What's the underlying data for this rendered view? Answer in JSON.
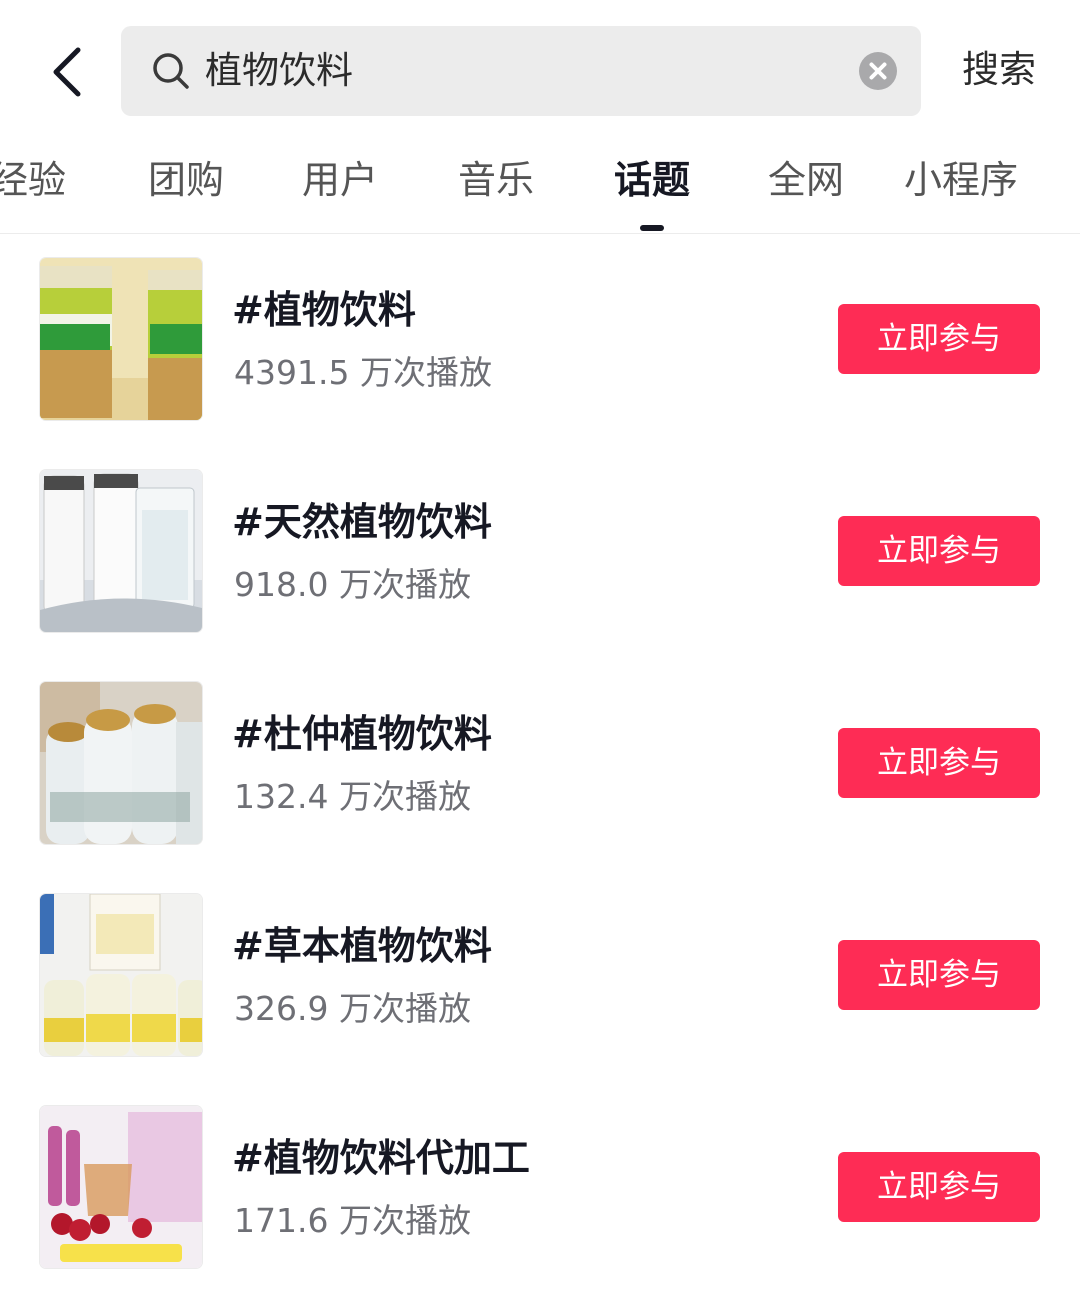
{
  "search": {
    "query": "植物饮料",
    "submit_label": "搜索"
  },
  "tabs": [
    {
      "label": "经验"
    },
    {
      "label": "团购"
    },
    {
      "label": "用户"
    },
    {
      "label": "音乐"
    },
    {
      "label": "话题",
      "active": true
    },
    {
      "label": "全网"
    },
    {
      "label": "小程序"
    }
  ],
  "topics": [
    {
      "title": "#植物饮料",
      "plays": "4391.5 万次播放",
      "action": "立即参与"
    },
    {
      "title": "#天然植物饮料",
      "plays": "918.0 万次播放",
      "action": "立即参与"
    },
    {
      "title": "#杜仲植物饮料",
      "plays": "132.4 万次播放",
      "action": "立即参与"
    },
    {
      "title": "#草本植物饮料",
      "plays": "326.9 万次播放",
      "action": "立即参与"
    },
    {
      "title": "#植物饮料代加工",
      "plays": "171.6 万次播放",
      "action": "立即参与"
    }
  ],
  "colors": {
    "accent": "#fe2c55",
    "search_bg": "#ececec",
    "text_primary": "#161823",
    "text_secondary": "#6e6f75"
  },
  "icons": {
    "back": "chevron-left-icon",
    "search": "search-icon",
    "clear": "clear-circle-icon"
  }
}
